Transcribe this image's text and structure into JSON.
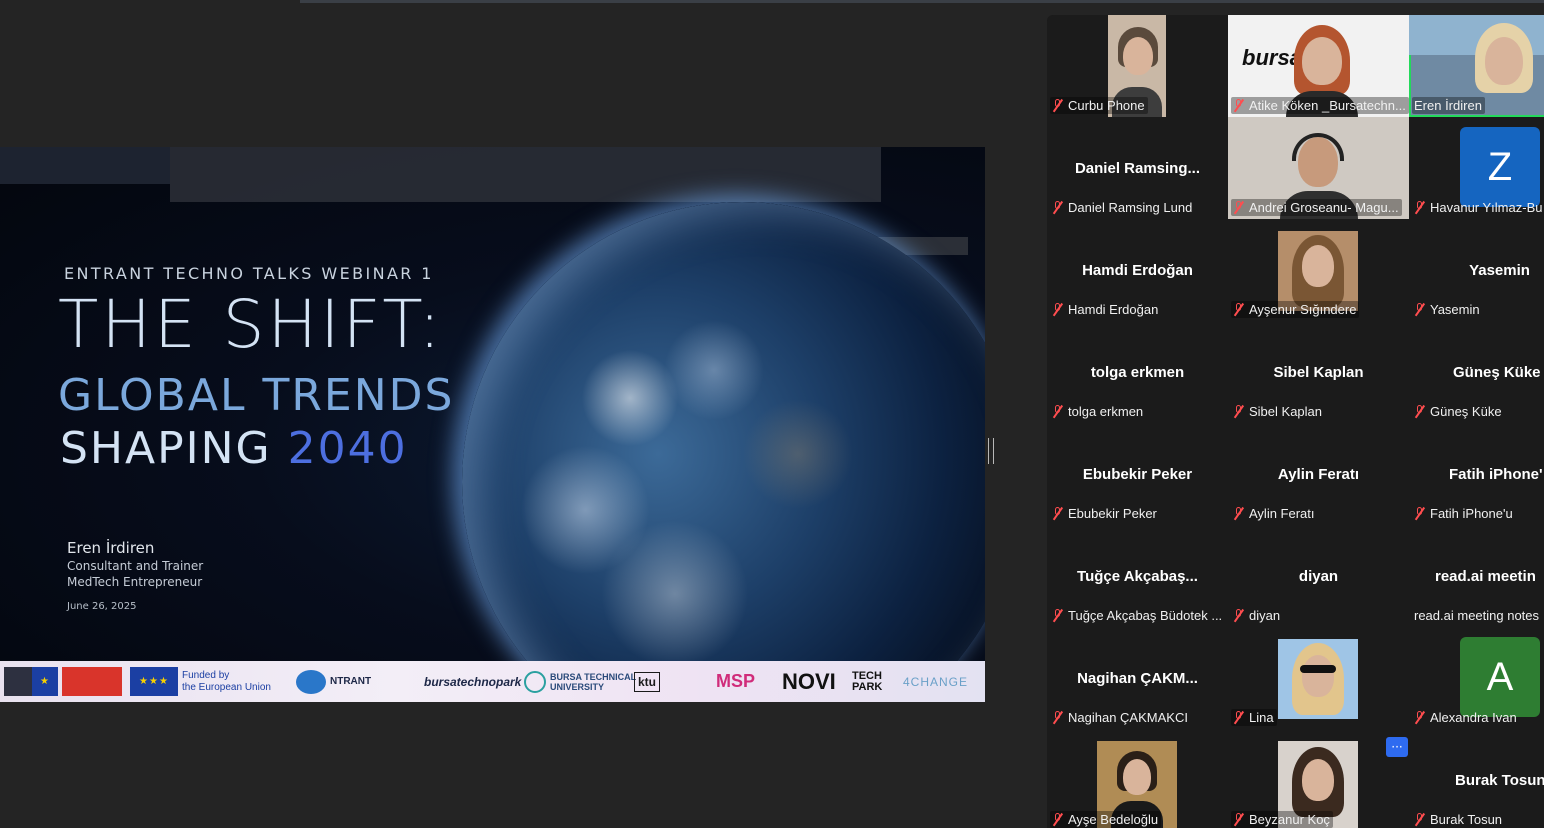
{
  "slide": {
    "webinar_label": "ENTRANT TECHNO TALKS WEBINAR 1",
    "title_main": "THE SHIFT:",
    "title_line2": "GLOBAL TRENDS",
    "title_line3": "SHAPING",
    "title_year": "2040",
    "presenter_name": "Eren İrdiren",
    "presenter_role1": "Consultant and Trainer",
    "presenter_role2": "MedTech Entrepreneur",
    "date": "June 26, 2025",
    "logos": {
      "eu_funded_line1": "Funded by",
      "eu_funded_line2": "the European Union",
      "entrant": "NTRANT",
      "bursatechnopark": "bursatechnopark",
      "btu_line1": "BURSA TECHNICAL",
      "btu_line2": "UNIVERSITY",
      "ktu": "ktu",
      "msp": "MSP",
      "novi": "NOVI",
      "techpark_line1": "TECH",
      "techpark_line2": "PARK",
      "change": "4CHANGE"
    }
  },
  "gallery": {
    "more_label": "···",
    "tiles": [
      {
        "name": "Curbu Phone"
      },
      {
        "name": "Atike Köken _Bursatechn...",
        "brand": "bursa"
      },
      {
        "name": "Eren İrdiren"
      },
      {
        "title": "Daniel  Ramsing...",
        "name": "Daniel Ramsing Lund"
      },
      {
        "name": "Andrei Groseanu- Magu..."
      },
      {
        "name": "Havanur Yılmaz-Bu",
        "letter": "Z"
      },
      {
        "title": "Hamdi Erdoğan",
        "name": "Hamdi Erdoğan"
      },
      {
        "name": "Ayşenur Sığındere"
      },
      {
        "title": "Yasemin",
        "name": "Yasemin"
      },
      {
        "title": "tolga erkmen",
        "name": "tolga erkmen"
      },
      {
        "title": "Sibel Kaplan",
        "name": "Sibel Kaplan"
      },
      {
        "title": "Güneş Küke",
        "name": "Güneş Küke"
      },
      {
        "title": "Ebubekir Peker",
        "name": "Ebubekir Peker"
      },
      {
        "title": "Aylin Feratı",
        "name": "Aylin Feratı"
      },
      {
        "title": "Fatih iPhone'",
        "name": "Fatih iPhone'u"
      },
      {
        "title": "Tuğçe  Akçabaş...",
        "name": "Tuğçe Akçabaş Büdotek ..."
      },
      {
        "title": "diyan",
        "name": "diyan"
      },
      {
        "title": "read.ai  meetin",
        "name": "read.ai meeting notes"
      },
      {
        "title": "Nagihan  ÇAKM...",
        "name": "Nagihan ÇAKMAKCI"
      },
      {
        "name": "Lina"
      },
      {
        "name": "Alexandra Ivan",
        "letter": "A"
      },
      {
        "name": "Ayşe Bedeloğlu"
      },
      {
        "name": "Beyzanur Koç"
      },
      {
        "title": "Burak Tosun",
        "name": "Burak Tosun"
      }
    ]
  },
  "colors": {
    "muted_mic": "#ff4d4f",
    "active_speaker": "#23d95b",
    "avatar_blue": "#1565c0",
    "avatar_green": "#2e7d32",
    "title_year": "#4d6fe0"
  }
}
